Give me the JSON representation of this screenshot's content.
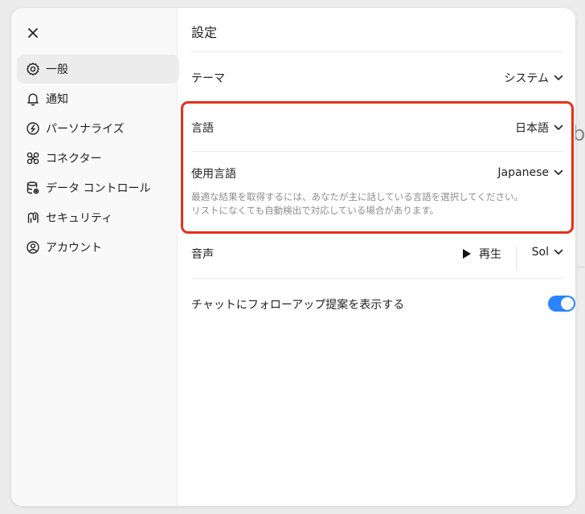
{
  "settings": {
    "title": "設定",
    "nav": [
      {
        "label": "一般",
        "icon": "gear-icon"
      },
      {
        "label": "通知",
        "icon": "bell-icon"
      },
      {
        "label": "パーソナライズ",
        "icon": "personalize-icon"
      },
      {
        "label": "コネクター",
        "icon": "connectors-icon"
      },
      {
        "label": "データ コントロール",
        "icon": "database-icon"
      },
      {
        "label": "セキュリティ",
        "icon": "security-icon"
      },
      {
        "label": "アカウント",
        "icon": "account-icon"
      }
    ],
    "rows": {
      "theme": {
        "label": "テーマ",
        "value": "システム"
      },
      "language": {
        "label": "言語",
        "value": "日本語"
      },
      "spoken_language": {
        "label": "使用言語",
        "value": "Japanese",
        "description": "最適な結果を取得するには、あなたが主に話している言語を選択してください。リストになくても自動検出で対応している場合があります。"
      },
      "voice": {
        "label": "音声",
        "play_label": "再生",
        "value": "Sol"
      },
      "followup": {
        "label": "チャットにフォローアップ提案を表示する",
        "enabled": true
      }
    }
  },
  "colors": {
    "accent": "#2a84ff",
    "highlight_border": "#e5301b"
  }
}
